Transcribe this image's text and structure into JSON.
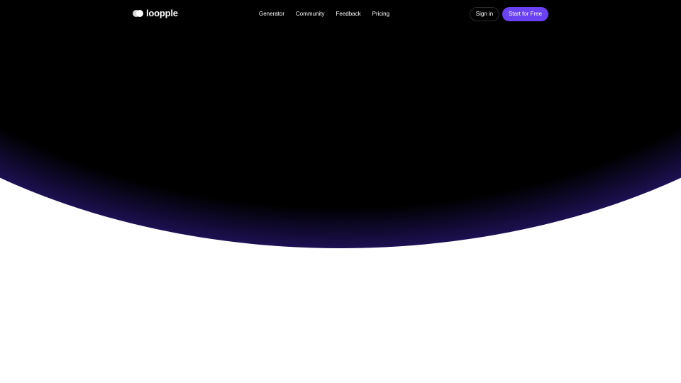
{
  "brand": {
    "name": "loopple",
    "logo_icon": "loopple-logo-icon"
  },
  "nav": {
    "links": [
      {
        "label": "Generator"
      },
      {
        "label": "Community"
      },
      {
        "label": "Feedback"
      },
      {
        "label": "Pricing"
      }
    ]
  },
  "actions": {
    "signin_label": "Sign in",
    "start_label": "Start for Free"
  },
  "colors": {
    "accent": "#6a42f2",
    "hero_dark": "#000000",
    "background": "#ffffff"
  }
}
